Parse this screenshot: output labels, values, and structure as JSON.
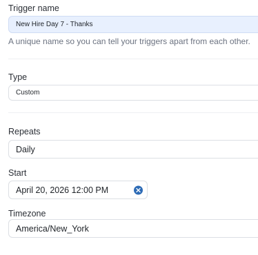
{
  "trigger_name": {
    "label": "Trigger name",
    "value": "New Hire Day 7 - Thanks",
    "help": "A unique name so you can tell your triggers apart from each other."
  },
  "type": {
    "label": "Type",
    "value": "Custom"
  },
  "repeats": {
    "label": "Repeats",
    "value": "Daily"
  },
  "start": {
    "label": "Start",
    "value": "April 20, 2026 12:00 PM",
    "clear_icon": "clear-x-circle-icon"
  },
  "timezone": {
    "label": "Timezone",
    "value": "America/New_York"
  },
  "colors": {
    "focused_bg": "#e8f0fe",
    "clear_icon": "#2d6bb6",
    "help_text": "#6b7280"
  }
}
